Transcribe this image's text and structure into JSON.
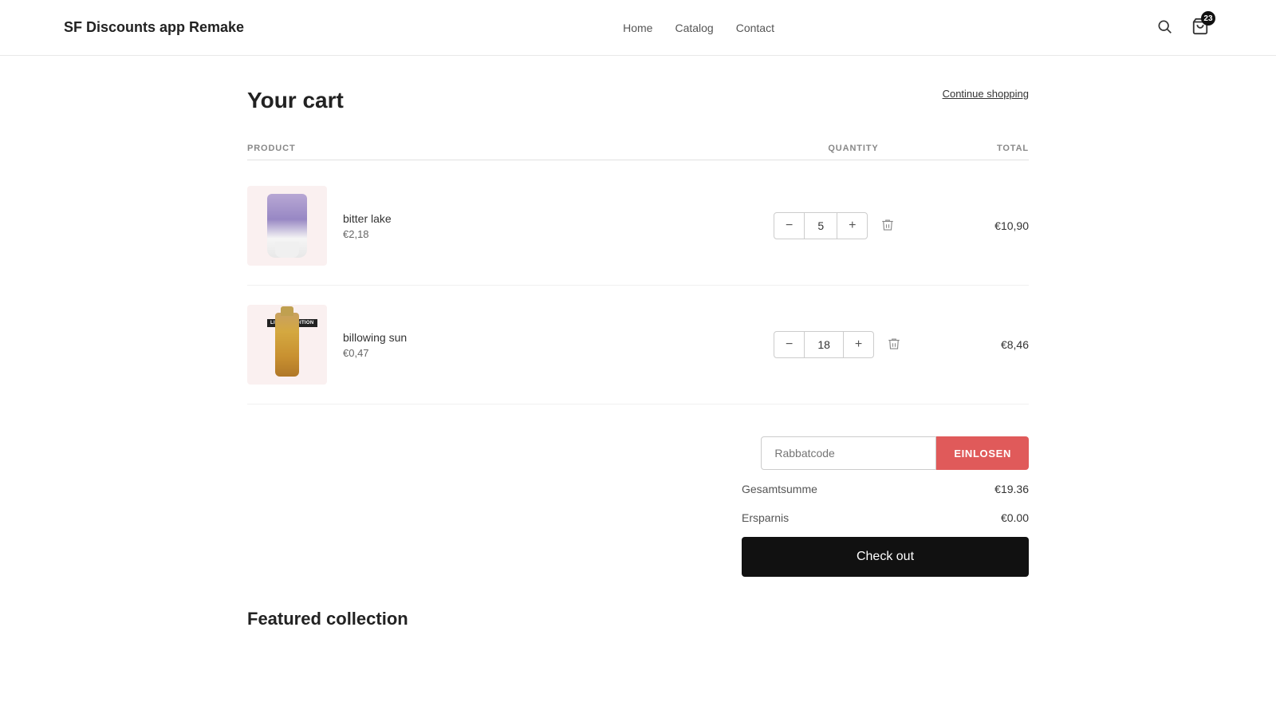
{
  "header": {
    "logo": "SF Discounts app Remake",
    "nav": [
      {
        "label": "Home",
        "href": "#"
      },
      {
        "label": "Catalog",
        "href": "#"
      },
      {
        "label": "Contact",
        "href": "#"
      }
    ],
    "cart_count": "23"
  },
  "page": {
    "title": "Your cart",
    "continue_shopping": "Continue shopping"
  },
  "table_headers": {
    "product": "PRODUCT",
    "quantity": "QUANTITY",
    "total": "TOTAL"
  },
  "items": [
    {
      "id": "item-1",
      "name": "bitter lake",
      "price": "€2,18",
      "quantity": 5,
      "total": "€10,90",
      "image_type": "tube-purple"
    },
    {
      "id": "item-2",
      "name": "billowing sun",
      "price": "€0,47",
      "quantity": 18,
      "total": "€8,46",
      "image_type": "bottle-gold",
      "badge": "LIMITED EDITION"
    }
  ],
  "discount": {
    "placeholder": "Rabbatcode",
    "button_label": "EINLOSEN"
  },
  "summary": {
    "subtotal_label": "Gesamtsumme",
    "subtotal_value": "€19.36",
    "savings_label": "Ersparnis",
    "savings_value": "€0.00"
  },
  "checkout_label": "Check out",
  "featured": {
    "title": "Featured collection"
  }
}
